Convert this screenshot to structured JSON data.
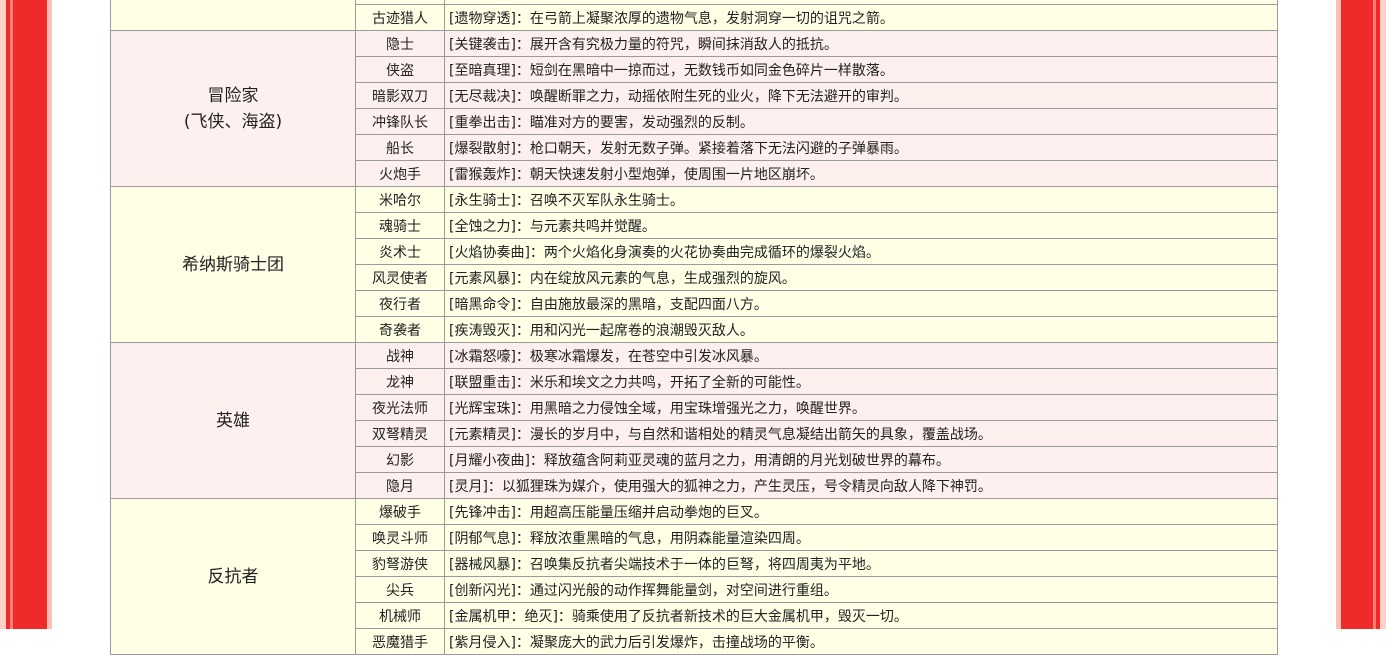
{
  "groups": [
    {
      "category": [
        "",
        ""
      ],
      "theme": "yellow",
      "rows": [
        {
          "job": "",
          "skill": ""
        },
        {
          "job": "古迹猎人",
          "skill": "[遗物穿透]：在弓箭上凝聚浓厚的遗物气息，发射洞穿一切的诅咒之箭。"
        }
      ]
    },
    {
      "category": [
        "冒险家",
        "(飞侠、海盗)"
      ],
      "theme": "pink",
      "rows": [
        {
          "job": "隐士",
          "skill": "[关键袭击]：展开含有究极力量的符咒，瞬间抹消敌人的抵抗。"
        },
        {
          "job": "侠盗",
          "skill": "[至暗真理]：短剑在黑暗中一掠而过，无数钱币如同金色碎片一样散落。"
        },
        {
          "job": "暗影双刀",
          "skill": "[无尽裁决]：唤醒断罪之力，动摇依附生死的业火，降下无法避开的审判。"
        },
        {
          "job": "冲锋队长",
          "skill": "[重拳出击]：瞄准对方的要害，发动强烈的反制。"
        },
        {
          "job": "船长",
          "skill": "[爆裂散射]：枪口朝天，发射无数子弹。紧接着落下无法闪避的子弹暴雨。"
        },
        {
          "job": "火炮手",
          "skill": "[雷猴轰炸]：朝天快速发射小型炮弹，使周围一片地区崩坏。"
        }
      ]
    },
    {
      "category": [
        "希纳斯骑士团",
        ""
      ],
      "theme": "yellow",
      "rows": [
        {
          "job": "米哈尔",
          "skill": "[永生骑士]：召唤不灭军队永生骑士。"
        },
        {
          "job": "魂骑士",
          "skill": "[全蚀之力]：与元素共鸣并觉醒。"
        },
        {
          "job": "炎术士",
          "skill": "[火焰协奏曲]：两个火焰化身演奏的火花协奏曲完成循环的爆裂火焰。"
        },
        {
          "job": "风灵使者",
          "skill": "[元素风暴]：内在绽放风元素的气息，生成强烈的旋风。"
        },
        {
          "job": "夜行者",
          "skill": "[暗黑命令]：自由施放最深的黑暗，支配四面八方。"
        },
        {
          "job": "奇袭者",
          "skill": "[疾涛毁灭]：用和闪光一起席卷的浪潮毁灭敌人。"
        }
      ]
    },
    {
      "category": [
        "英雄",
        ""
      ],
      "theme": "pink",
      "rows": [
        {
          "job": "战神",
          "skill": "[冰霜怒嚎]：极寒冰霜爆发，在苍空中引发冰风暴。"
        },
        {
          "job": "龙神",
          "skill": "[联盟重击]：米乐和埃文之力共鸣，开拓了全新的可能性。"
        },
        {
          "job": "夜光法师",
          "skill": "[光辉宝珠]：用黑暗之力侵蚀全域，用宝珠增强光之力，唤醒世界。"
        },
        {
          "job": "双弩精灵",
          "skill": "[元素精灵]：漫长的岁月中，与自然和谐相处的精灵气息凝结出箭矢的具象，覆盖战场。"
        },
        {
          "job": "幻影",
          "skill": "[月耀小夜曲]：释放蕴含阿莉亚灵魂的蓝月之力，用清朗的月光划破世界的幕布。"
        },
        {
          "job": "隐月",
          "skill": "[灵月]：以狐狸珠为媒介，使用强大的狐神之力，产生灵压，号令精灵向敌人降下神罚。"
        }
      ]
    },
    {
      "category": [
        "反抗者",
        ""
      ],
      "theme": "yellow",
      "rows": [
        {
          "job": "爆破手",
          "skill": "[先锋冲击]：用超高压能量压缩并启动拳炮的巨叉。"
        },
        {
          "job": "唤灵斗师",
          "skill": "[阴郁气息]：释放浓重黑暗的气息，用阴森能量渲染四周。"
        },
        {
          "job": "豹弩游侠",
          "skill": "[器械风暴]：召唤集反抗者尖端技术于一体的巨弩，将四周夷为平地。"
        },
        {
          "job": "尖兵",
          "skill": "[创新闪光]：通过闪光般的动作挥舞能量剑，对空间进行重组。"
        },
        {
          "job": "机械师",
          "skill": "[金属机甲：绝灭]：骑乘使用了反抗者新技术的巨大金属机甲，毁灭一切。"
        },
        {
          "job": "恶魔猎手",
          "skill": "[紫月侵入]：凝聚庞大的武力后引发爆炸，击撞战场的平衡。"
        }
      ]
    }
  ]
}
